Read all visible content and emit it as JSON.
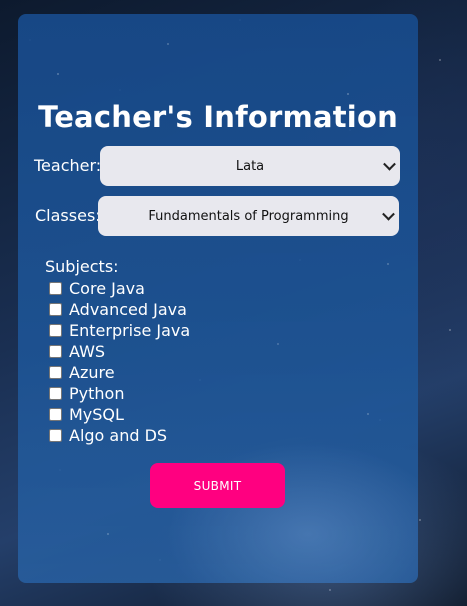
{
  "form": {
    "title": "Teacher's Information",
    "teacher_label": "Teacher:",
    "teacher_value": "Lata",
    "classes_label": "Classes:",
    "classes_value": "Fundamentals of Programming",
    "subjects_label": "Subjects:",
    "subjects": [
      {
        "label": "Core Java",
        "checked": false
      },
      {
        "label": "Advanced Java",
        "checked": false
      },
      {
        "label": "Enterprise Java",
        "checked": false
      },
      {
        "label": "AWS",
        "checked": false
      },
      {
        "label": "Azure",
        "checked": false
      },
      {
        "label": "Python",
        "checked": false
      },
      {
        "label": "MySQL",
        "checked": false
      },
      {
        "label": "Algo and DS",
        "checked": false
      }
    ],
    "submit_label": "SUBMIT"
  },
  "colors": {
    "submit_bg": "#ff0080",
    "card_bg": "#1e5596",
    "select_bg": "#e8e8ee"
  }
}
